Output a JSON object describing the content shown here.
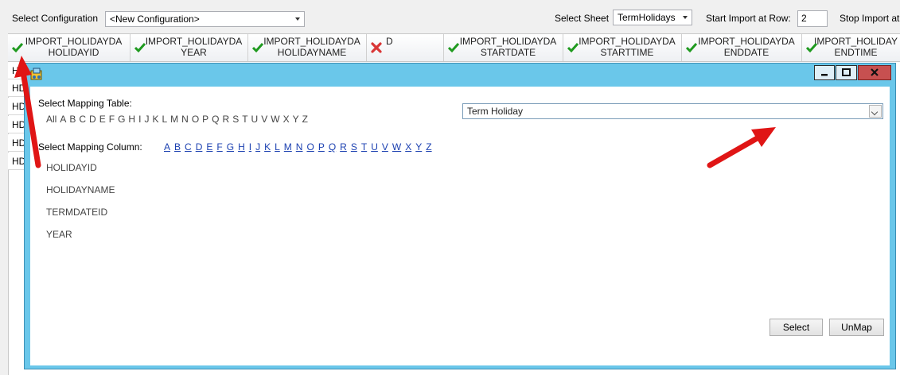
{
  "toolbar": {
    "select_config_label": "Select Configuration",
    "config_value": "<New Configuration>",
    "select_sheet_label": "Select Sheet",
    "sheet_value": "TermHolidays",
    "start_row_label": "Start Import at Row:",
    "start_row_value": "2",
    "stop_label": "Stop Import at"
  },
  "grid": {
    "columns": [
      {
        "line1": "IMPORT_HOLIDAYDA",
        "line2": "HOLIDAYID",
        "status": "ok"
      },
      {
        "line1": "IMPORT_HOLIDAYDA",
        "line2": "YEAR",
        "status": "ok"
      },
      {
        "line1": "IMPORT_HOLIDAYDA",
        "line2": "HOLIDAYNAME",
        "status": "ok"
      },
      {
        "line1": "D",
        "line2": "",
        "status": "error"
      },
      {
        "line1": "IMPORT_HOLIDAYDA",
        "line2": "STARTDATE",
        "status": "ok"
      },
      {
        "line1": "IMPORT_HOLIDAYDA",
        "line2": "STARTTIME",
        "status": "ok"
      },
      {
        "line1": "IMPORT_HOLIDAYDA",
        "line2": "ENDDATE",
        "status": "ok"
      },
      {
        "line1": "IMPORT_HOLIDAY",
        "line2": "ENDTIME",
        "status": "ok"
      }
    ],
    "row_stubs": [
      "HO",
      "HD",
      "HD",
      "HD",
      "HD",
      "HD"
    ]
  },
  "dialog": {
    "mapping_table_label": "Select Mapping Table:",
    "table_letters": [
      "All",
      "A",
      "B",
      "C",
      "D",
      "E",
      "F",
      "G",
      "H",
      "I",
      "J",
      "K",
      "L",
      "M",
      "N",
      "O",
      "P",
      "Q",
      "R",
      "S",
      "T",
      "U",
      "V",
      "W",
      "X",
      "Y",
      "Z"
    ],
    "table_value": "Term Holiday",
    "mapping_column_label": "Select Mapping Column:",
    "column_letters": [
      "A",
      "B",
      "C",
      "D",
      "E",
      "F",
      "G",
      "H",
      "I",
      "J",
      "K",
      "L",
      "M",
      "N",
      "O",
      "P",
      "Q",
      "R",
      "S",
      "T",
      "U",
      "V",
      "W",
      "X",
      "Y",
      "Z"
    ],
    "columns": [
      "HOLIDAYID",
      "HOLIDAYNAME",
      "TERMDATEID",
      "YEAR"
    ],
    "select_button": "Select",
    "unmap_button": "UnMap"
  },
  "colors": {
    "dialog_frame": "#6ac7ea",
    "check_green": "#1f9a1f",
    "error_red": "#d93636",
    "link_blue": "#1a3fb0",
    "annotation_red": "#e01515"
  }
}
